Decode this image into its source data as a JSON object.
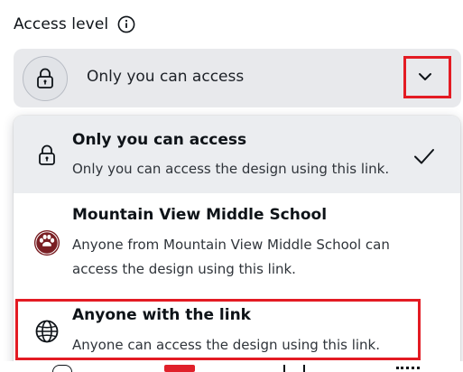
{
  "access": {
    "heading": "Access level",
    "current_value": "Only you can access"
  },
  "options": [
    {
      "title": "Only you can access",
      "desc_lines": [
        "Only you can access the design using this link."
      ],
      "icon": "lock-icon",
      "selected": true
    },
    {
      "title": "Mountain View Middle School",
      "desc_lines": [
        "Anyone from Mountain View Middle School can",
        "access the design using this link."
      ],
      "icon": "school-logo-icon",
      "selected": false
    },
    {
      "title": "Anyone with the link",
      "desc_lines": [
        "Anyone can access the design using this link."
      ],
      "icon": "globe-icon",
      "selected": false
    }
  ],
  "colors": {
    "highlight_outline": "#e31b23",
    "selected_row": "#ebedf0",
    "control_bg": "#e8e9ec",
    "school_logo": "#7a1f24"
  }
}
